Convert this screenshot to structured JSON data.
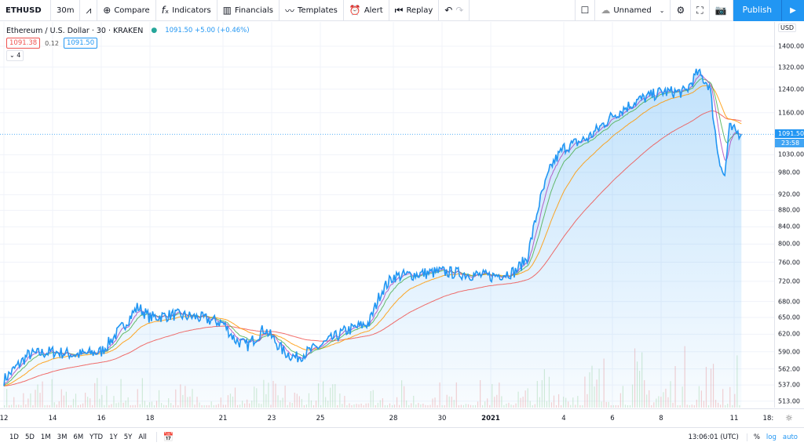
{
  "toolbar": {
    "symbol": "ETHUSD",
    "interval": "30m",
    "chart_type_icon": "area-chart-icon",
    "compare": "Compare",
    "indicators": "Indicators",
    "financials": "Financials",
    "templates": "Templates",
    "alert": "Alert",
    "replay": "Replay",
    "layout_name": "Unnamed",
    "publish": "Publish"
  },
  "legend": {
    "title": "Ethereum / U.S. Dollar · 30 · KRAKEN",
    "quote": "1091.50 +5.00 (+0.46%)",
    "bid": "1091.38",
    "spread": "0.12",
    "ask": "1091.50",
    "indicators_count": "4"
  },
  "colors": {
    "line": "#2196f3",
    "bid": "#ef5350",
    "ask": "#2196f3",
    "publish": "#2196f3",
    "ma": [
      "#ef5350",
      "#ff9800",
      "#4caf50",
      "#ab47bc"
    ]
  },
  "price_axis": {
    "currency": "USD",
    "labels": [
      "1400.00",
      "1320.00",
      "1240.00",
      "1160.00",
      "1030.00",
      "980.00",
      "920.00",
      "880.00",
      "840.00",
      "800.00",
      "760.00",
      "720.00",
      "680.00",
      "650.00",
      "620.00",
      "590.00",
      "562.00",
      "537.00",
      "513.00"
    ],
    "last_price": "1091.50",
    "countdown": "23:58"
  },
  "time_axis": {
    "labels": [
      "12",
      "14",
      "16",
      "18",
      "21",
      "23",
      "25",
      "28",
      "30",
      "2021",
      "4",
      "6",
      "8",
      "11",
      "18:"
    ]
  },
  "bottom": {
    "ranges": [
      "1D",
      "5D",
      "1M",
      "3M",
      "6M",
      "YTD",
      "1Y",
      "5Y",
      "All"
    ],
    "clock": "13:06:01 (UTC)",
    "percent": "%",
    "log": "log",
    "auto": "auto"
  },
  "chart_data": {
    "type": "area",
    "scale": "log",
    "ylim": [
      500,
      1450
    ],
    "x_unit": "days since Dec 12 (date axis: Dec 12 2020 – Jan 11 2021)",
    "x": [
      0,
      1,
      2,
      3,
      4,
      5,
      5.5,
      6,
      7,
      8,
      9,
      9.5,
      10,
      10.7,
      11,
      11.5,
      12,
      13,
      14,
      15,
      15.5,
      16,
      17,
      18,
      19,
      20,
      21,
      21.5,
      22,
      22.5,
      23,
      24,
      25,
      26,
      27,
      28,
      28.5,
      29,
      29.3,
      29.6,
      29.8,
      30.3
    ],
    "y": [
      545,
      585,
      590,
      585,
      590,
      640,
      670,
      650,
      655,
      650,
      640,
      610,
      600,
      630,
      615,
      590,
      580,
      600,
      625,
      640,
      700,
      730,
      735,
      740,
      735,
      730,
      740,
      770,
      900,
      1000,
      1050,
      1080,
      1150,
      1200,
      1230,
      1230,
      1300,
      1250,
      1050,
      960,
      1110,
      1091.5
    ]
  }
}
